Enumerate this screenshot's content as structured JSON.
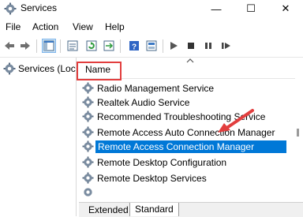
{
  "window": {
    "title": "Services",
    "icon": "services-gear-icon",
    "minimize": "—",
    "maximize": "☐",
    "close": "✕"
  },
  "menu": [
    "File",
    "Action",
    "View",
    "Help"
  ],
  "toolbar_icons": [
    "back-arrow-icon",
    "forward-arrow-icon",
    "console-tree-icon",
    "properties-icon",
    "refresh-icon",
    "export-icon",
    "help-icon",
    "mmc-icon",
    "start-icon",
    "stop-icon",
    "pause-icon",
    "restart-icon"
  ],
  "left_pane": {
    "tree_item": "Services (Local)"
  },
  "list": {
    "column_header": "Name",
    "rows": [
      {
        "name": "Radio Management Service"
      },
      {
        "name": "Realtek Audio Service"
      },
      {
        "name": "Recommended Troubleshooting Service"
      },
      {
        "name": "Remote Access Auto Connection Manager"
      },
      {
        "name": "Remote Access Connection Manager",
        "selected": true
      },
      {
        "name": "Remote Desktop Configuration"
      },
      {
        "name": "Remote Desktop Services"
      }
    ]
  },
  "tabs": [
    "Extended",
    "Standard"
  ],
  "colors": {
    "selection": "#0078d7",
    "annotation": "#e23e3e"
  }
}
